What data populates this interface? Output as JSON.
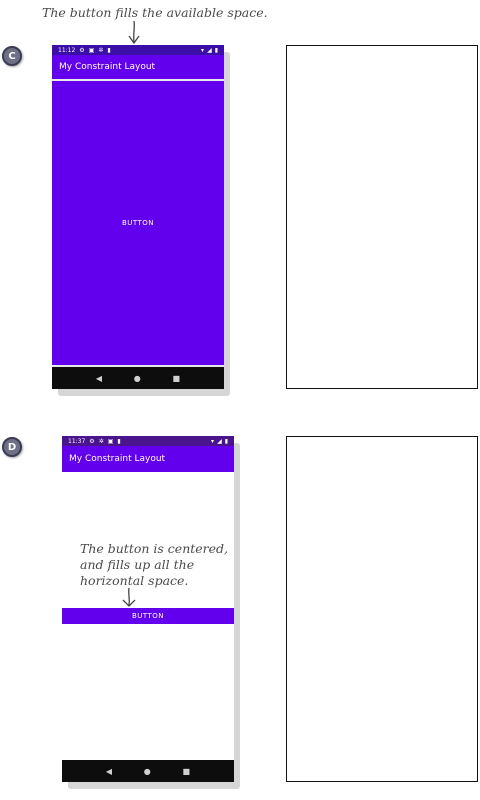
{
  "annotations": {
    "top_note": "The button fills the available space.",
    "bottom_note_lines": [
      "The button is centered,",
      "and fills up all the",
      "horizontal space."
    ]
  },
  "badges": {
    "c": "C",
    "d": "D"
  },
  "phone_c": {
    "status_time": "11:12",
    "app_title": "My Constraint Layout",
    "button_label": "BUTTON"
  },
  "phone_d": {
    "status_time": "11:37",
    "app_title": "My Constraint Layout",
    "button_label": "BUTTON"
  },
  "nav": {
    "back": "◀",
    "home": "●",
    "recents": "■"
  },
  "icons": [
    "arrow-down-icon",
    "gear-icon",
    "battery-icon",
    "wifi-icon",
    "signal-icon"
  ],
  "colors": {
    "primary": "#6200ee",
    "status": "#4a148c",
    "frame": "#151515"
  }
}
